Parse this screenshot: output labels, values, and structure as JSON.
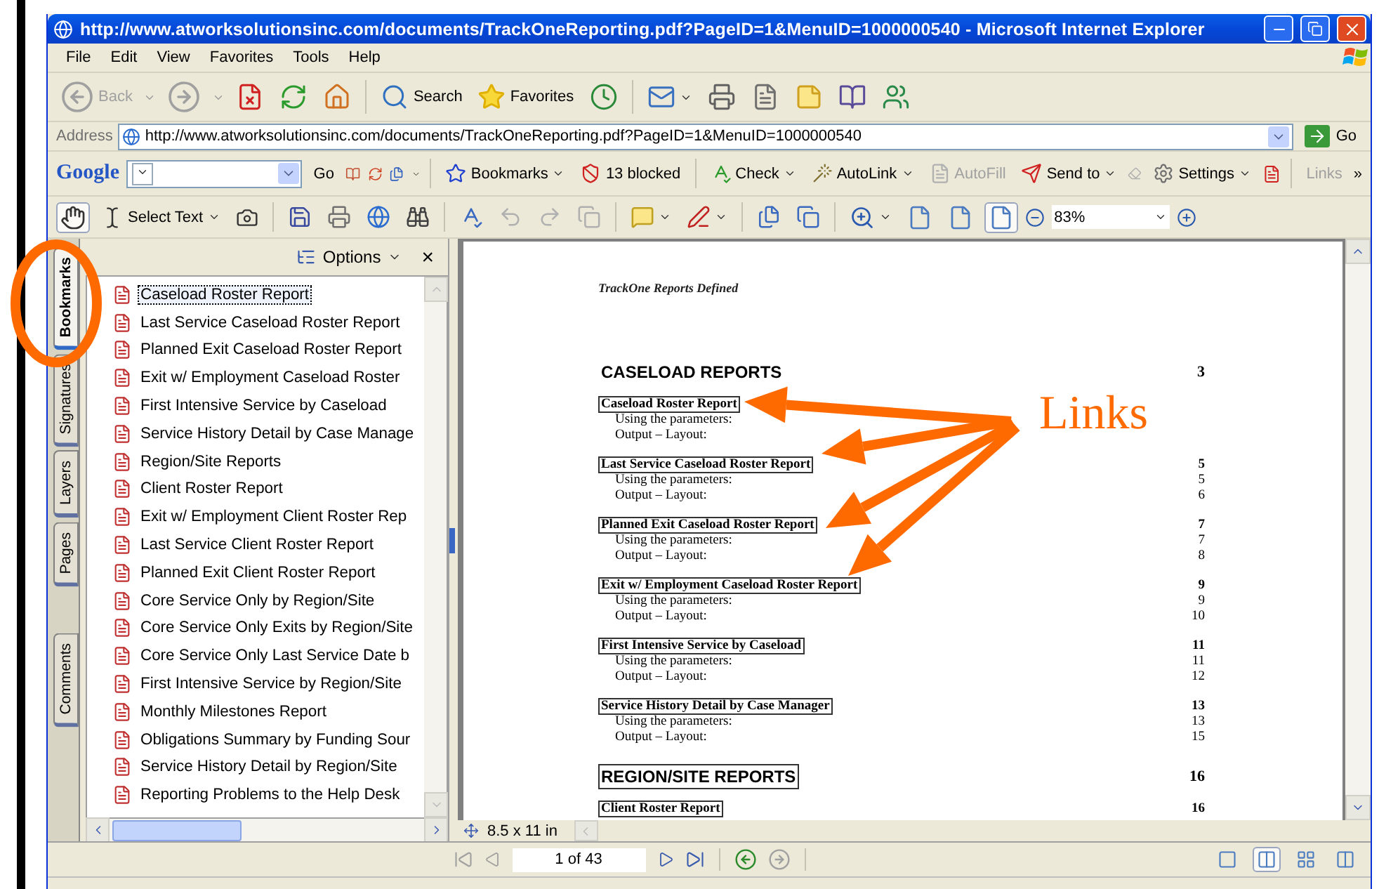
{
  "window": {
    "title": "http://www.atworksolutionsinc.com/documents/TrackOneReporting.pdf?PageID=1&MenuID=1000000540 - Microsoft Internet Explorer"
  },
  "menu": [
    "File",
    "Edit",
    "View",
    "Favorites",
    "Tools",
    "Help"
  ],
  "toolbar": {
    "back": {
      "label": "Back",
      "disabled": true
    },
    "search": {
      "label": "Search"
    },
    "favorites": {
      "label": "Favorites"
    }
  },
  "address": {
    "label": "Address",
    "url": "http://www.atworksolutionsinc.com/documents/TrackOneReporting.pdf?PageID=1&MenuID=1000000540",
    "go": "Go"
  },
  "google_bar": {
    "logo": "Google",
    "go": "Go",
    "bookmarks": "Bookmarks",
    "blocked": "13 blocked",
    "check": "Check",
    "autolink": "AutoLink",
    "autofill": {
      "label": "AutoFill",
      "disabled": true
    },
    "send_to": "Send to",
    "settings": "Settings",
    "links": "Links",
    "more": "»"
  },
  "acrobat_bar": {
    "hand_tool": {
      "selected": true
    },
    "select_text": {
      "label": "Select Text",
      "selected": false
    },
    "view_modes": [
      {
        "selected": false
      },
      {
        "selected": false
      },
      {
        "selected": true
      }
    ],
    "zoom": "83%"
  },
  "side_tabs": [
    {
      "label": "Bookmarks",
      "selected": true
    },
    {
      "label": "Signatures",
      "selected": false
    },
    {
      "label": "Layers",
      "selected": false
    },
    {
      "label": "Pages",
      "selected": false
    },
    {
      "label": "Comments",
      "selected": false
    }
  ],
  "bookmarks": {
    "options": "Options",
    "close": "×",
    "items": [
      {
        "label": "Caseload Roster Report",
        "selected": true
      },
      {
        "label": "Last Service Caseload Roster Report",
        "selected": false
      },
      {
        "label": "Planned Exit Caseload Roster Report",
        "selected": false
      },
      {
        "label": "Exit w/ Employment Caseload Roster",
        "selected": false
      },
      {
        "label": "First Intensive Service by Caseload",
        "selected": false
      },
      {
        "label": "Service History Detail by Case Manage",
        "selected": false
      },
      {
        "label": "Region/Site Reports",
        "selected": false
      },
      {
        "label": "Client Roster Report",
        "selected": false
      },
      {
        "label": "Exit w/ Employment Client Roster Rep",
        "selected": false
      },
      {
        "label": "Last Service Client Roster Report",
        "selected": false
      },
      {
        "label": "Planned Exit Client Roster Report",
        "selected": false
      },
      {
        "label": "Core Service Only by Region/Site",
        "selected": false
      },
      {
        "label": "Core Service Only Exits by Region/Site",
        "selected": false
      },
      {
        "label": "Core Service Only Last Service Date b",
        "selected": false
      },
      {
        "label": "First Intensive Service by Region/Site",
        "selected": false
      },
      {
        "label": "Monthly Milestones Report",
        "selected": false
      },
      {
        "label": "Obligations Summary by Funding Sour",
        "selected": false
      },
      {
        "label": "Service History Detail by Region/Site",
        "selected": false
      },
      {
        "label": "Reporting Problems to the Help Desk",
        "selected": false
      }
    ]
  },
  "document": {
    "header": "TrackOne Reports Defined",
    "items": [
      {
        "kind": "heading",
        "title": "CASELOAD REPORTS",
        "page": "3",
        "boxed": false
      },
      {
        "kind": "entry",
        "title": "Caseload Roster Report",
        "rows": [
          {
            "label": "Using the parameters:"
          },
          {
            "label": "Output – Layout:"
          }
        ]
      },
      {
        "kind": "entry",
        "title": "Last Service Caseload Roster Report",
        "page": "5",
        "rows": [
          {
            "label": "Using the parameters:",
            "page": "5"
          },
          {
            "label": "Output – Layout:",
            "page": "6"
          }
        ]
      },
      {
        "kind": "entry",
        "title": "Planned Exit Caseload Roster Report",
        "page": "7",
        "rows": [
          {
            "label": "Using the parameters:",
            "page": "7"
          },
          {
            "label": "Output – Layout:",
            "page": "8"
          }
        ]
      },
      {
        "kind": "entry",
        "title": "Exit w/ Employment Caseload Roster Report",
        "page": "9",
        "rows": [
          {
            "label": "Using the parameters:",
            "page": "9"
          },
          {
            "label": "Output – Layout:",
            "page": "10"
          }
        ]
      },
      {
        "kind": "entry",
        "title": "First Intensive Service by Caseload",
        "page": "11",
        "rows": [
          {
            "label": "Using the parameters:",
            "page": "11"
          },
          {
            "label": "Output – Layout:",
            "page": "12"
          }
        ]
      },
      {
        "kind": "entry",
        "title": "Service History Detail by Case Manager",
        "page": "13",
        "rows": [
          {
            "label": "Using the parameters:",
            "page": "13"
          },
          {
            "label": "Output – Layout:",
            "page": "15"
          }
        ]
      },
      {
        "kind": "heading",
        "title": "REGION/SITE REPORTS",
        "page": "16",
        "boxed": true
      },
      {
        "kind": "entry",
        "title": "Client Roster Report",
        "page": "16"
      }
    ]
  },
  "status": {
    "page_size": "8.5 x 11 in",
    "page": "1 of 43",
    "layouts": [
      {
        "selected": false
      },
      {
        "selected": true
      },
      {
        "selected": false
      },
      {
        "selected": false
      }
    ]
  },
  "annotation": {
    "label": "Links"
  }
}
